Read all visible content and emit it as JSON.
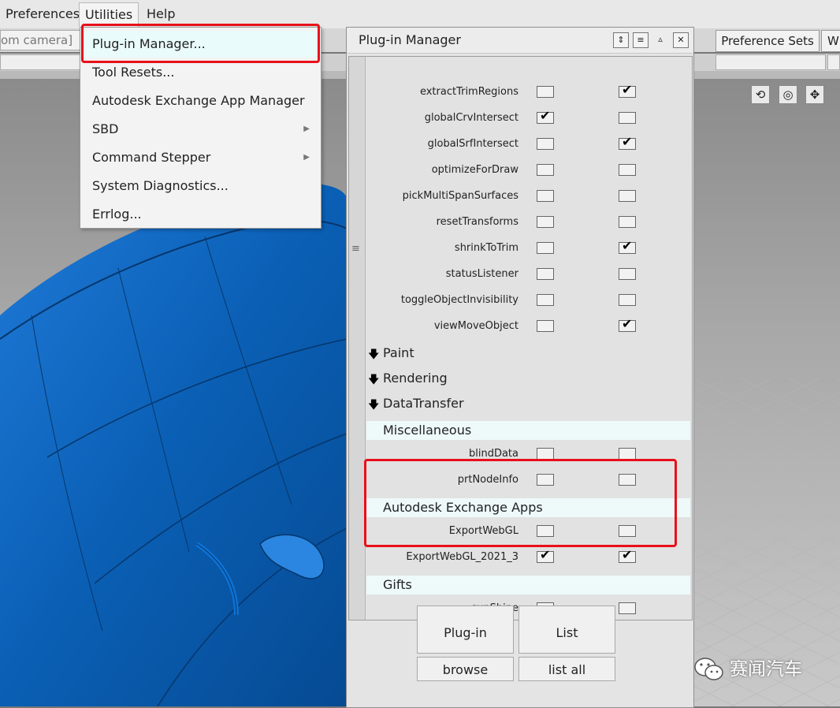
{
  "menubar": {
    "items": [
      "Preferences",
      "Utilities",
      "Help"
    ],
    "active": "Utilities"
  },
  "toolbar": {
    "camera_field": "om camera]",
    "preference_sets": "Preference Sets",
    "w_tab": "W"
  },
  "utilities_menu": {
    "items": [
      {
        "label": "Plug-in Manager..."
      },
      {
        "label": "Tool Resets..."
      },
      {
        "label": "Autodesk Exchange App Manager"
      },
      {
        "label": "SBD",
        "submenu": true
      },
      {
        "label": "Command Stepper",
        "submenu": true
      },
      {
        "label": "System Diagnostics..."
      },
      {
        "label": "Errlog..."
      }
    ]
  },
  "plugin_manager": {
    "title": "Plug-in Manager",
    "rows_top": [
      {
        "name": "extractTrimRegions",
        "c1": false,
        "c2": true
      },
      {
        "name": "globalCrvIntersect",
        "c1": true,
        "c2": false
      },
      {
        "name": "globalSrfIntersect",
        "c1": false,
        "c2": true
      },
      {
        "name": "optimizeForDraw",
        "c1": false,
        "c2": false
      },
      {
        "name": "pickMultiSpanSurfaces",
        "c1": false,
        "c2": false
      },
      {
        "name": "resetTransforms",
        "c1": false,
        "c2": false
      },
      {
        "name": "shrinkToTrim",
        "c1": false,
        "c2": true
      },
      {
        "name": "statusListener",
        "c1": false,
        "c2": false
      },
      {
        "name": "toggleObjectInvisibility",
        "c1": false,
        "c2": false
      },
      {
        "name": "viewMoveObject",
        "c1": false,
        "c2": true
      }
    ],
    "collapsed_sections": [
      "Paint",
      "Rendering",
      "DataTransfer"
    ],
    "misc": {
      "title": "Miscellaneous",
      "rows": [
        {
          "name": "blindData",
          "c1": false,
          "c2": false
        },
        {
          "name": "prtNodeInfo",
          "c1": false,
          "c2": false
        }
      ]
    },
    "exchange": {
      "title": "Autodesk Exchange Apps",
      "rows": [
        {
          "name": "ExportWebGL",
          "c1": false,
          "c2": false
        },
        {
          "name": "ExportWebGL_2021_3",
          "c1": true,
          "c2": true
        }
      ]
    },
    "gifts": {
      "title": "Gifts",
      "rows": [
        {
          "name": "sunShine",
          "c1": false,
          "c2": false
        }
      ]
    },
    "buttons": {
      "plugin": "Plug-in",
      "list": "List",
      "browse": "browse",
      "list_all": "list all"
    }
  },
  "watermark": {
    "text": "赛闻汽车"
  },
  "colors": {
    "highlight_box": "#e8101a",
    "car_body": "#0a5fb4",
    "menu_highlight": "#eafbfc"
  }
}
